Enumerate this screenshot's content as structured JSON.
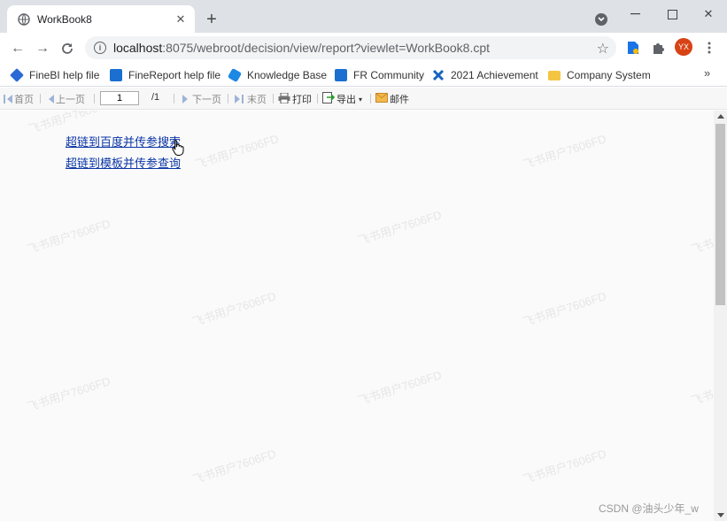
{
  "browser": {
    "tab_title": "WorkBook8",
    "url_host": "localhost",
    "url_rest": ":8075/webroot/decision/view/report?viewlet=WorkBook8.cpt",
    "avatar_initials": "YX"
  },
  "bookmarks": [
    {
      "label": "FineBI help file",
      "icon": "finebi-icon",
      "color": "#2b6ad6"
    },
    {
      "label": "FineReport help file",
      "icon": "finereport-icon",
      "color": "#1a6fd1"
    },
    {
      "label": "Knowledge Base",
      "icon": "cube-icon",
      "color": "#1e88e5"
    },
    {
      "label": "FR Community",
      "icon": "finereport-icon",
      "color": "#1a6fd1"
    },
    {
      "label": "2021 Achievement",
      "icon": "cross-icon",
      "color": "#1565c0"
    },
    {
      "label": "Company System",
      "icon": "folder-icon",
      "color": "#f4c542"
    }
  ],
  "report_toolbar": {
    "first": "首页",
    "prev": "上一页",
    "page_value": "1",
    "page_total": "/1",
    "next": "下一页",
    "last": "末页",
    "print": "打印",
    "export": "导出",
    "mail": "邮件"
  },
  "report": {
    "links": [
      "超链到百度并传参搜索",
      "超链到模板并传参查询"
    ],
    "watermark_text": "飞书用户7606FD"
  },
  "credit": "CSDN @油头少年_w"
}
